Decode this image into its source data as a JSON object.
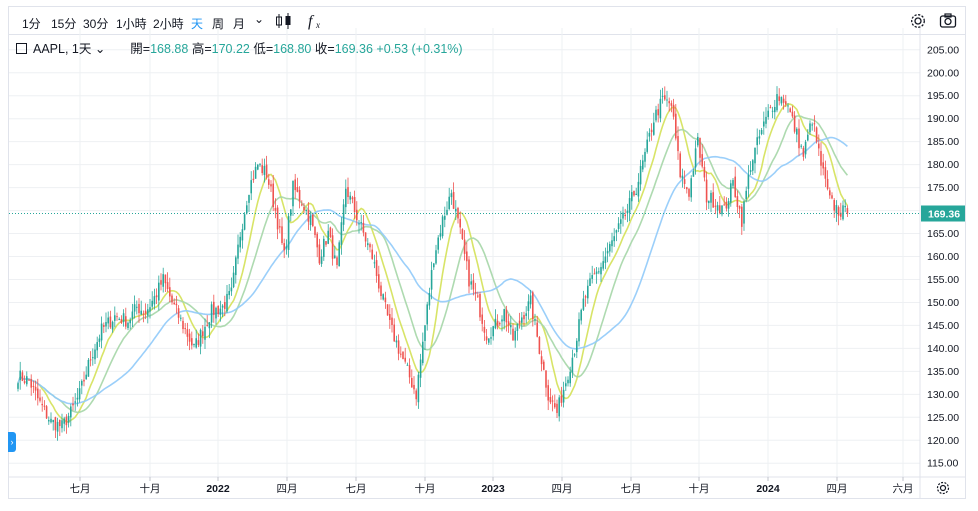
{
  "toolbar": {
    "intervals": [
      "1分",
      "15分",
      "30分",
      "1小時",
      "2小時",
      "天",
      "周",
      "月"
    ],
    "active_interval": "天",
    "chevron": "⌄",
    "icons": [
      "candles-icon",
      "fx-icon",
      "settings-icon",
      "camera-icon"
    ]
  },
  "legend": {
    "symbol": "AAPL, 1天",
    "open_label": "開=",
    "open": "168.88",
    "high_label": "高=",
    "high": "170.22",
    "low_label": "低=",
    "low": "168.80",
    "close_label": "收=",
    "close": "169.36",
    "change": "+0.53 (+0.31%)"
  },
  "colors": {
    "up": "#26a69a",
    "down": "#ef5350",
    "ma_fast": "#a5d6a7",
    "ma_mid": "#d4e157",
    "ma_slow": "#90caf9",
    "price_line": "#26a69a",
    "grid": "#eef0f3"
  },
  "chart_data": {
    "type": "candlestick",
    "symbol": "AAPL",
    "interval": "1天",
    "last_price": 169.36,
    "last_price_label": "169.36",
    "ylim": [
      112,
      208
    ],
    "y_ticks": [
      "115.00",
      "120.00",
      "125.00",
      "130.00",
      "135.00",
      "140.00",
      "145.00",
      "150.00",
      "155.00",
      "160.00",
      "165.00",
      "170.00",
      "175.00",
      "180.00",
      "185.00",
      "190.00",
      "195.00",
      "200.00",
      "205.00"
    ],
    "x_ticks": [
      {
        "label": "七月",
        "bold": false
      },
      {
        "label": "十月",
        "bold": false
      },
      {
        "label": "2022",
        "bold": true
      },
      {
        "label": "四月",
        "bold": false
      },
      {
        "label": "七月",
        "bold": false
      },
      {
        "label": "十月",
        "bold": false
      },
      {
        "label": "2023",
        "bold": true
      },
      {
        "label": "四月",
        "bold": false
      },
      {
        "label": "七月",
        "bold": false
      },
      {
        "label": "十月",
        "bold": false
      },
      {
        "label": "2024",
        "bold": true
      },
      {
        "label": "四月",
        "bold": false
      },
      {
        "label": "六月",
        "bold": false
      }
    ],
    "anchors": [
      [
        0,
        134
      ],
      [
        5,
        133
      ],
      [
        10,
        128
      ],
      [
        15,
        124
      ],
      [
        20,
        123
      ],
      [
        24,
        126
      ],
      [
        28,
        130
      ],
      [
        33,
        138
      ],
      [
        38,
        144
      ],
      [
        44,
        147
      ],
      [
        50,
        146
      ],
      [
        54,
        149
      ],
      [
        58,
        148
      ],
      [
        62,
        151
      ],
      [
        66,
        155
      ],
      [
        70,
        150
      ],
      [
        75,
        145
      ],
      [
        80,
        140
      ],
      [
        84,
        144
      ],
      [
        88,
        148
      ],
      [
        93,
        149
      ],
      [
        97,
        152
      ],
      [
        101,
        165
      ],
      [
        105,
        175
      ],
      [
        109,
        180
      ],
      [
        113,
        178
      ],
      [
        117,
        170
      ],
      [
        121,
        160
      ],
      [
        125,
        175
      ],
      [
        129,
        172
      ],
      [
        133,
        168
      ],
      [
        137,
        160
      ],
      [
        141,
        165
      ],
      [
        145,
        157
      ],
      [
        149,
        175
      ],
      [
        153,
        170
      ],
      [
        157,
        165
      ],
      [
        161,
        160
      ],
      [
        165,
        152
      ],
      [
        169,
        145
      ],
      [
        173,
        140
      ],
      [
        177,
        135
      ],
      [
        181,
        130
      ],
      [
        185,
        145
      ],
      [
        189,
        160
      ],
      [
        193,
        168
      ],
      [
        197,
        174
      ],
      [
        201,
        165
      ],
      [
        205,
        155
      ],
      [
        209,
        150
      ],
      [
        213,
        143
      ],
      [
        217,
        145
      ],
      [
        221,
        148
      ],
      [
        225,
        142
      ],
      [
        229,
        147
      ],
      [
        233,
        150
      ],
      [
        237,
        140
      ],
      [
        241,
        130
      ],
      [
        245,
        126
      ],
      [
        249,
        133
      ],
      [
        253,
        140
      ],
      [
        257,
        150
      ],
      [
        261,
        155
      ],
      [
        265,
        158
      ],
      [
        269,
        162
      ],
      [
        273,
        166
      ],
      [
        277,
        170
      ],
      [
        281,
        175
      ],
      [
        285,
        182
      ],
      [
        289,
        190
      ],
      [
        293,
        194
      ],
      [
        297,
        193
      ],
      [
        301,
        178
      ],
      [
        305,
        174
      ],
      [
        309,
        185
      ],
      [
        313,
        173
      ],
      [
        317,
        172
      ],
      [
        321,
        170
      ],
      [
        325,
        176
      ],
      [
        329,
        168
      ],
      [
        333,
        180
      ],
      [
        337,
        186
      ],
      [
        341,
        191
      ],
      [
        345,
        195
      ],
      [
        349,
        194
      ],
      [
        353,
        188
      ],
      [
        357,
        182
      ],
      [
        361,
        190
      ],
      [
        365,
        180
      ],
      [
        369,
        172
      ],
      [
        373,
        170
      ],
      [
        377,
        169.4
      ]
    ]
  }
}
